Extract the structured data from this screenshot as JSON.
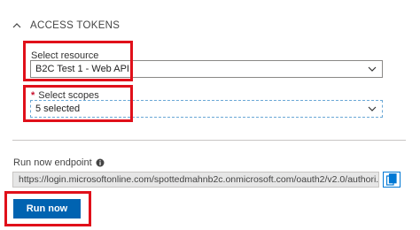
{
  "section": {
    "title": "ACCESS TOKENS"
  },
  "resource": {
    "label": "Select resource",
    "value": "B2C Test 1 - Web API"
  },
  "scopes": {
    "required_mark": "*",
    "label": "Select scopes",
    "value": "5 selected"
  },
  "endpoint": {
    "label": "Run now endpoint",
    "url": "https://login.microsoftonline.com/spottedmahnb2c.onmicrosoft.com/oauth2/v2.0/authori..."
  },
  "run_button": {
    "label": "Run now"
  },
  "colors": {
    "accent": "#0063b1",
    "highlight": "#e0101a",
    "required": "#c8102e"
  }
}
